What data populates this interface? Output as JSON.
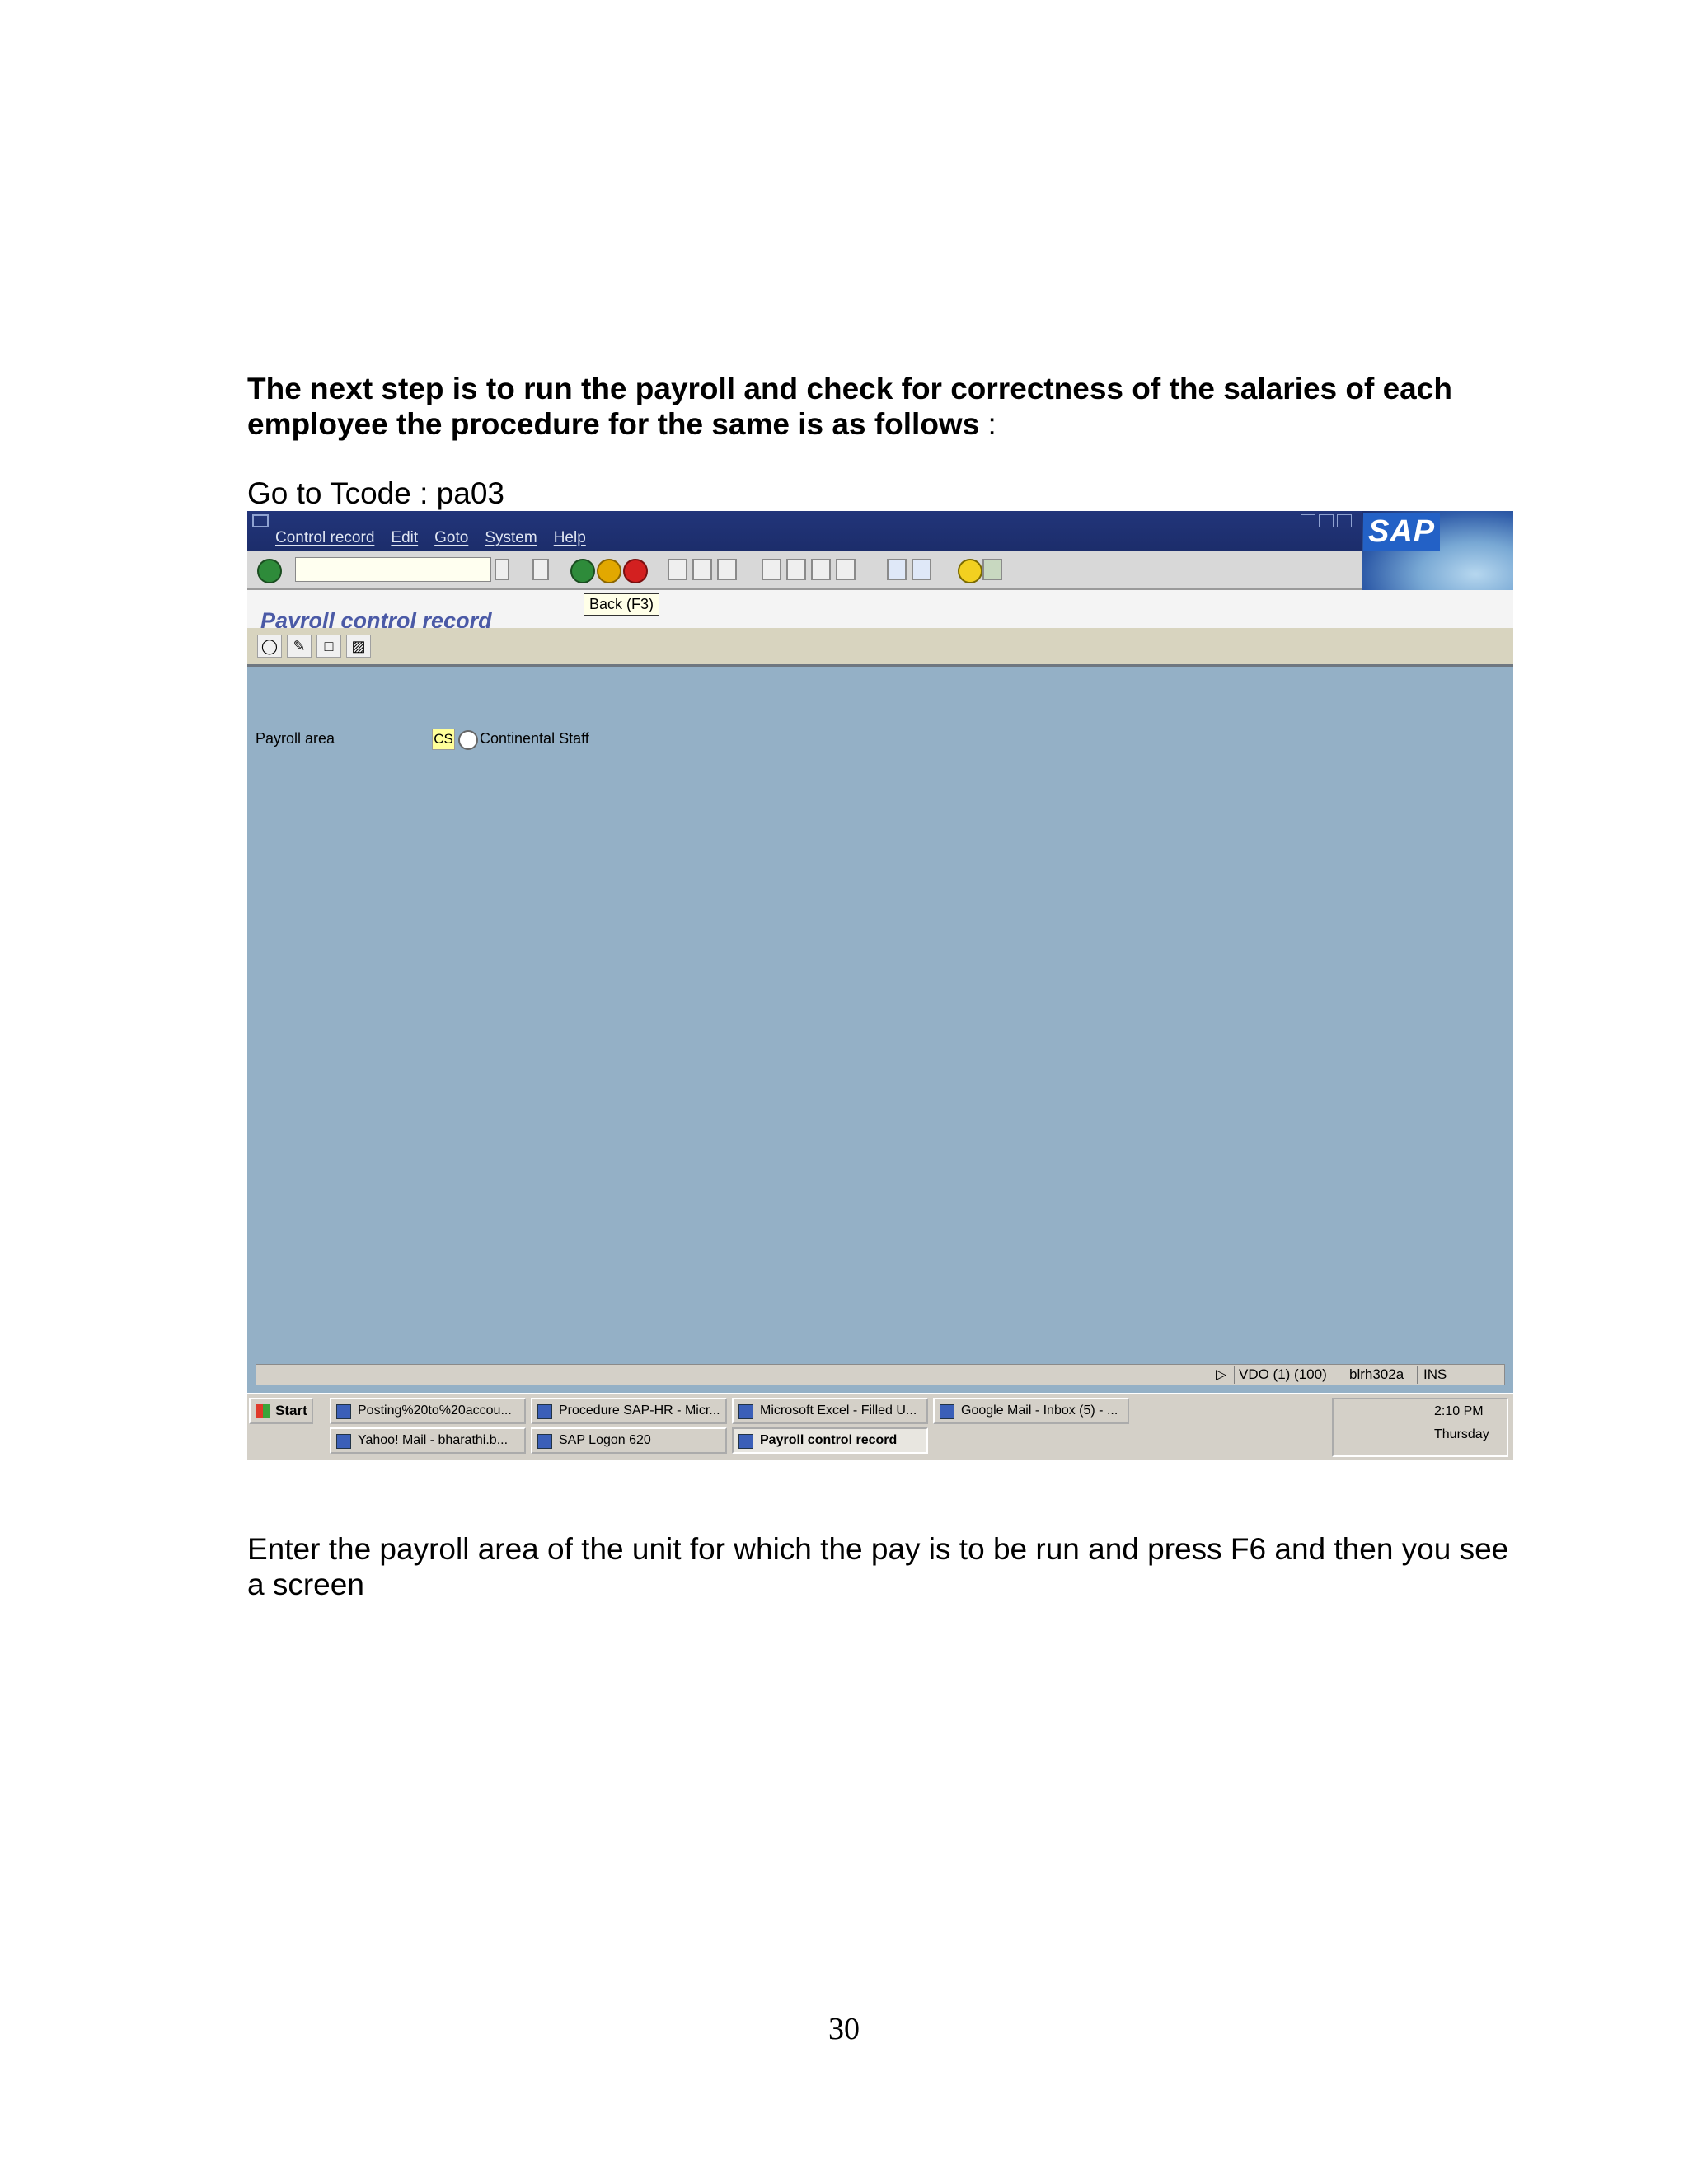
{
  "document": {
    "heading_bold": "The next step is to run the payroll and check for correctness of the salaries of each employee the procedure for the same is as follows",
    "heading_tail": " :",
    "tcode_line": "Go to Tcode : pa03",
    "after_text": "Enter the payroll area of the unit for which the pay is to be run and press F6 and then you see a screen",
    "page_number": "30"
  },
  "sap": {
    "menu": [
      "Control record",
      "Edit",
      "Goto",
      "System",
      "Help"
    ],
    "logo_text": "SAP",
    "screen_title": "Payroll control record",
    "tooltip": "Back  (F3)",
    "field": {
      "label": "Payroll area",
      "value": "CS",
      "description": "Continental Staff"
    },
    "status": {
      "system": "VDO (1) (100)",
      "server": "blrh302a",
      "mode": "INS"
    },
    "toolbar_icons": [
      "enter-icon",
      "command-field",
      "save-icon",
      "back-icon",
      "exit-icon",
      "cancel-icon",
      "print-icon",
      "find-icon",
      "find-next-icon",
      "first-page-icon",
      "prev-page-icon",
      "next-page-icon",
      "last-page-icon",
      "create-session-icon",
      "shortcut-icon",
      "help-icon",
      "layout-icon"
    ],
    "app_toolbar_icons": [
      "display-icon",
      "change-icon",
      "create-icon",
      "delete-icon"
    ]
  },
  "taskbar": {
    "start": "Start",
    "tasks": [
      "Posting%20to%20accou...",
      "Procedure SAP-HR - Micr...",
      "Microsoft Excel - Filled U...",
      "Google Mail - Inbox (5) - ...",
      "Yahoo! Mail - bharathi.b...",
      "SAP Logon 620",
      "Payroll control record"
    ],
    "time": "2:10 PM",
    "day": "Thursday"
  },
  "colors": {
    "menubar": "#1c2d6b",
    "screen_bg": "#94b0c6",
    "title_text": "#4b5aa6",
    "field_highlight": "#ffff99"
  }
}
